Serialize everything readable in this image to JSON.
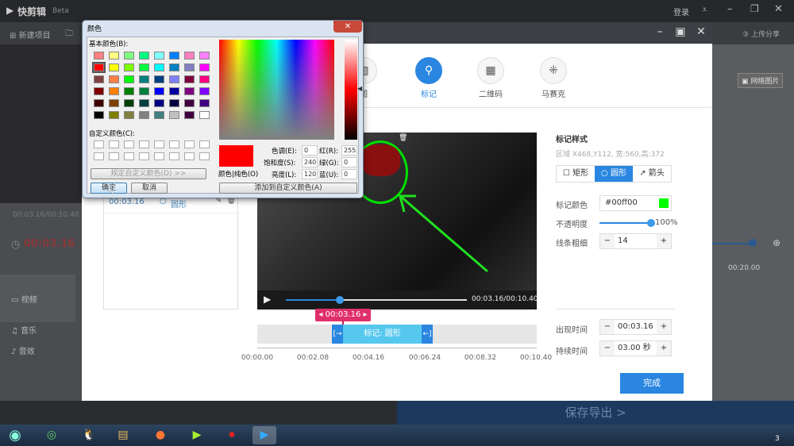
{
  "app": {
    "title": "快剪辑",
    "badge": "Beta",
    "login": "登录",
    "new_project": "新建项目",
    "upload_share": "上传分享",
    "online_video": "视频",
    "online_image": "网络图片",
    "current_time": "00:03.16",
    "video_time": "00:03.16/00:10.40",
    "timeline_label": "00:20.00",
    "tracks": [
      {
        "label": "视频"
      },
      {
        "label": "音乐"
      },
      {
        "label": "音效"
      }
    ],
    "export": "保存导出 >"
  },
  "modal": {
    "tabs": [
      {
        "label": "图",
        "icon": "image-icon"
      },
      {
        "label": "标记",
        "icon": "pin-icon",
        "active": true
      },
      {
        "label": "二维码",
        "icon": "qrcode-icon"
      },
      {
        "label": "马赛克",
        "icon": "mosaic-icon"
      }
    ],
    "list": [
      {
        "time": "00:03.16",
        "shape": "圆形"
      }
    ],
    "player": {
      "time": "00:03.16/00:10.40",
      "progress": 0.3
    },
    "marker_tag": "00:03.16",
    "segment_label": "标记: 圆形",
    "axis_ticks": [
      "00:00.00",
      "00:02.08",
      "00:04.16",
      "00:06.24",
      "00:08.32",
      "00:10.40"
    ],
    "style": {
      "title": "标记样式",
      "region": "区域 X468,Y112, 宽:560,高:372",
      "shapes": [
        "矩形",
        "圆形",
        "箭头"
      ],
      "active_shape": "圆形",
      "color_label": "标记颜色",
      "color_value": "#00ff00",
      "opacity_label": "不透明度",
      "opacity": "100%",
      "width_label": "线条粗细",
      "width_value": "14",
      "appear_label": "出现时间",
      "appear_value": "00:03.16",
      "duration_label": "持续时间",
      "duration_value": "03.00 秒"
    },
    "done": "完成"
  },
  "color_dialog": {
    "title": "颜色",
    "basic_label": "基本颜色(B):",
    "custom_label": "自定义颜色(C):",
    "define_button": "规定自定义颜色(D) >>",
    "ok": "确定",
    "cancel": "取消",
    "preview_label": "颜色|纯色(O)",
    "hue_label": "色调(E):",
    "hue": "0",
    "sat_label": "饱和度(S):",
    "sat": "240",
    "lum_label": "亮度(L):",
    "lum": "120",
    "red_label": "红(R):",
    "red": "255",
    "green_label": "绿(G):",
    "green": "0",
    "blue_label": "蓝(U):",
    "blue": "0",
    "add_custom": "添加到自定义颜色(A)",
    "selected_color": "#ff0000",
    "swatches": [
      "#ff8080",
      "#ffff80",
      "#80ff80",
      "#00ff80",
      "#80ffff",
      "#0080ff",
      "#ff80c0",
      "#ff80ff",
      "#ff0000",
      "#ffff00",
      "#80ff00",
      "#00ff40",
      "#00ffff",
      "#0080c0",
      "#8080c0",
      "#ff00ff",
      "#804040",
      "#ff8040",
      "#00ff00",
      "#008080",
      "#004080",
      "#8080ff",
      "#800040",
      "#ff0080",
      "#800000",
      "#ff8000",
      "#008000",
      "#008040",
      "#0000ff",
      "#0000a0",
      "#800080",
      "#8000ff",
      "#400000",
      "#804000",
      "#004000",
      "#004040",
      "#000080",
      "#000040",
      "#400040",
      "#400080",
      "#000000",
      "#808000",
      "#808040",
      "#808080",
      "#408080",
      "#c0c0c0",
      "#400040",
      "#ffffff"
    ]
  },
  "taskbar": {
    "clock": "3"
  }
}
